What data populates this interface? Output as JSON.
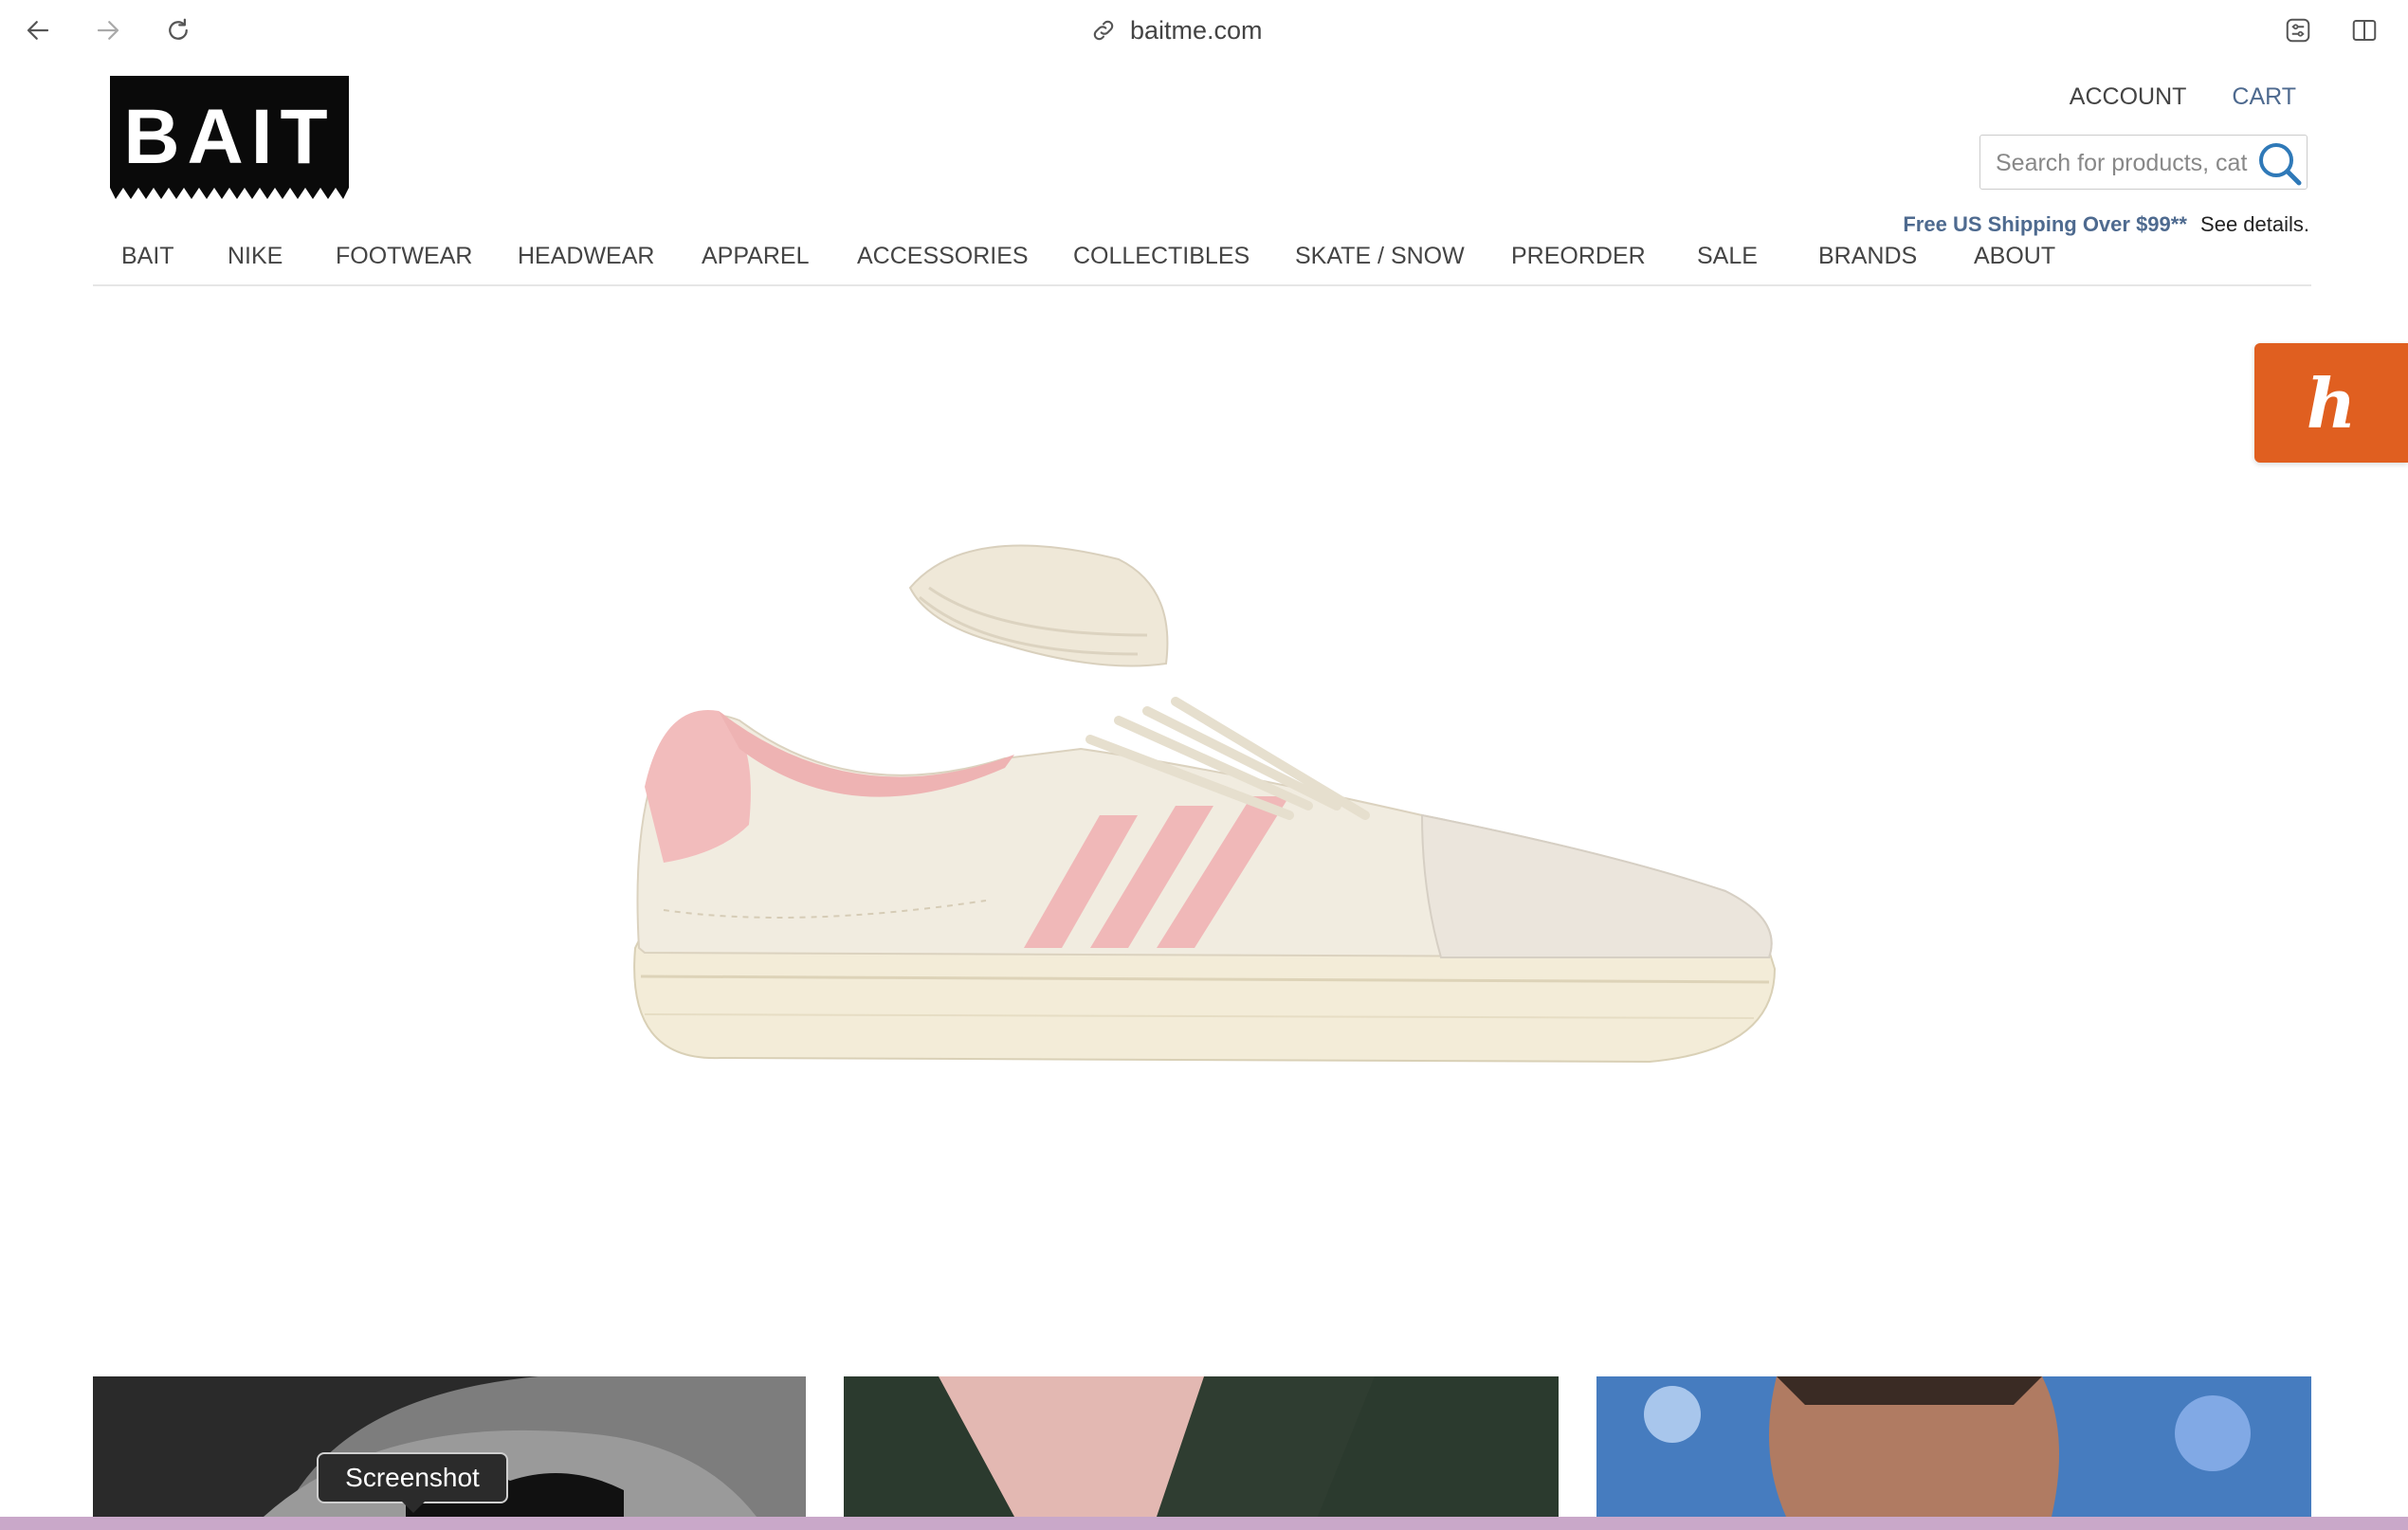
{
  "browser": {
    "url": "baitme.com",
    "icons": [
      "back-arrow-icon",
      "forward-arrow-icon",
      "reload-icon",
      "link-icon",
      "extension-icon",
      "sidebar-toggle-icon"
    ]
  },
  "header": {
    "logo_text": "BAIT",
    "account_label": "ACCOUNT",
    "cart_label": "CART",
    "search_placeholder": "Search for products, cat",
    "shipping_promo": "Free US Shipping Over $99**",
    "shipping_details": "See details."
  },
  "nav": {
    "items": [
      "BAIT",
      "NIKE",
      "FOOTWEAR",
      "HEADWEAR",
      "APPAREL",
      "ACCESSORIES",
      "COLLECTIBLES",
      "SKATE / SNOW",
      "PREORDER",
      "SALE",
      "BRANDS",
      "ABOUT"
    ]
  },
  "honey": {
    "letter": "h"
  },
  "tooltip": {
    "text": "Screenshot"
  },
  "colors": {
    "link_blue": "#4e6a8f",
    "honey_orange": "#e05f20",
    "shoe_pink": "#f0b8b8",
    "shoe_cream": "#f1ece0"
  }
}
